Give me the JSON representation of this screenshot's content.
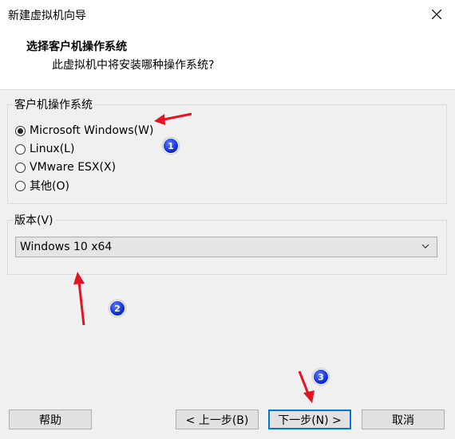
{
  "window": {
    "title": "新建虚拟机向导"
  },
  "header": {
    "title": "选择客户机操作系统",
    "subtitle": "此虚拟机中将安装哪种操作系统?"
  },
  "guest_os": {
    "label": "客户机操作系统",
    "options": [
      {
        "label": "Microsoft Windows(W)",
        "checked": true
      },
      {
        "label": "Linux(L)",
        "checked": false
      },
      {
        "label": "VMware ESX(X)",
        "checked": false
      },
      {
        "label": "其他(O)",
        "checked": false
      }
    ]
  },
  "version": {
    "label": "版本(V)",
    "selected": "Windows 10 x64"
  },
  "buttons": {
    "help": "帮助",
    "back": "< 上一步(B)",
    "next": "下一步(N) >",
    "cancel": "取消"
  },
  "annotations": {
    "markers": [
      "1",
      "2",
      "3"
    ],
    "arrow_color": "#e81123",
    "marker_color": "#0a2ad6"
  }
}
